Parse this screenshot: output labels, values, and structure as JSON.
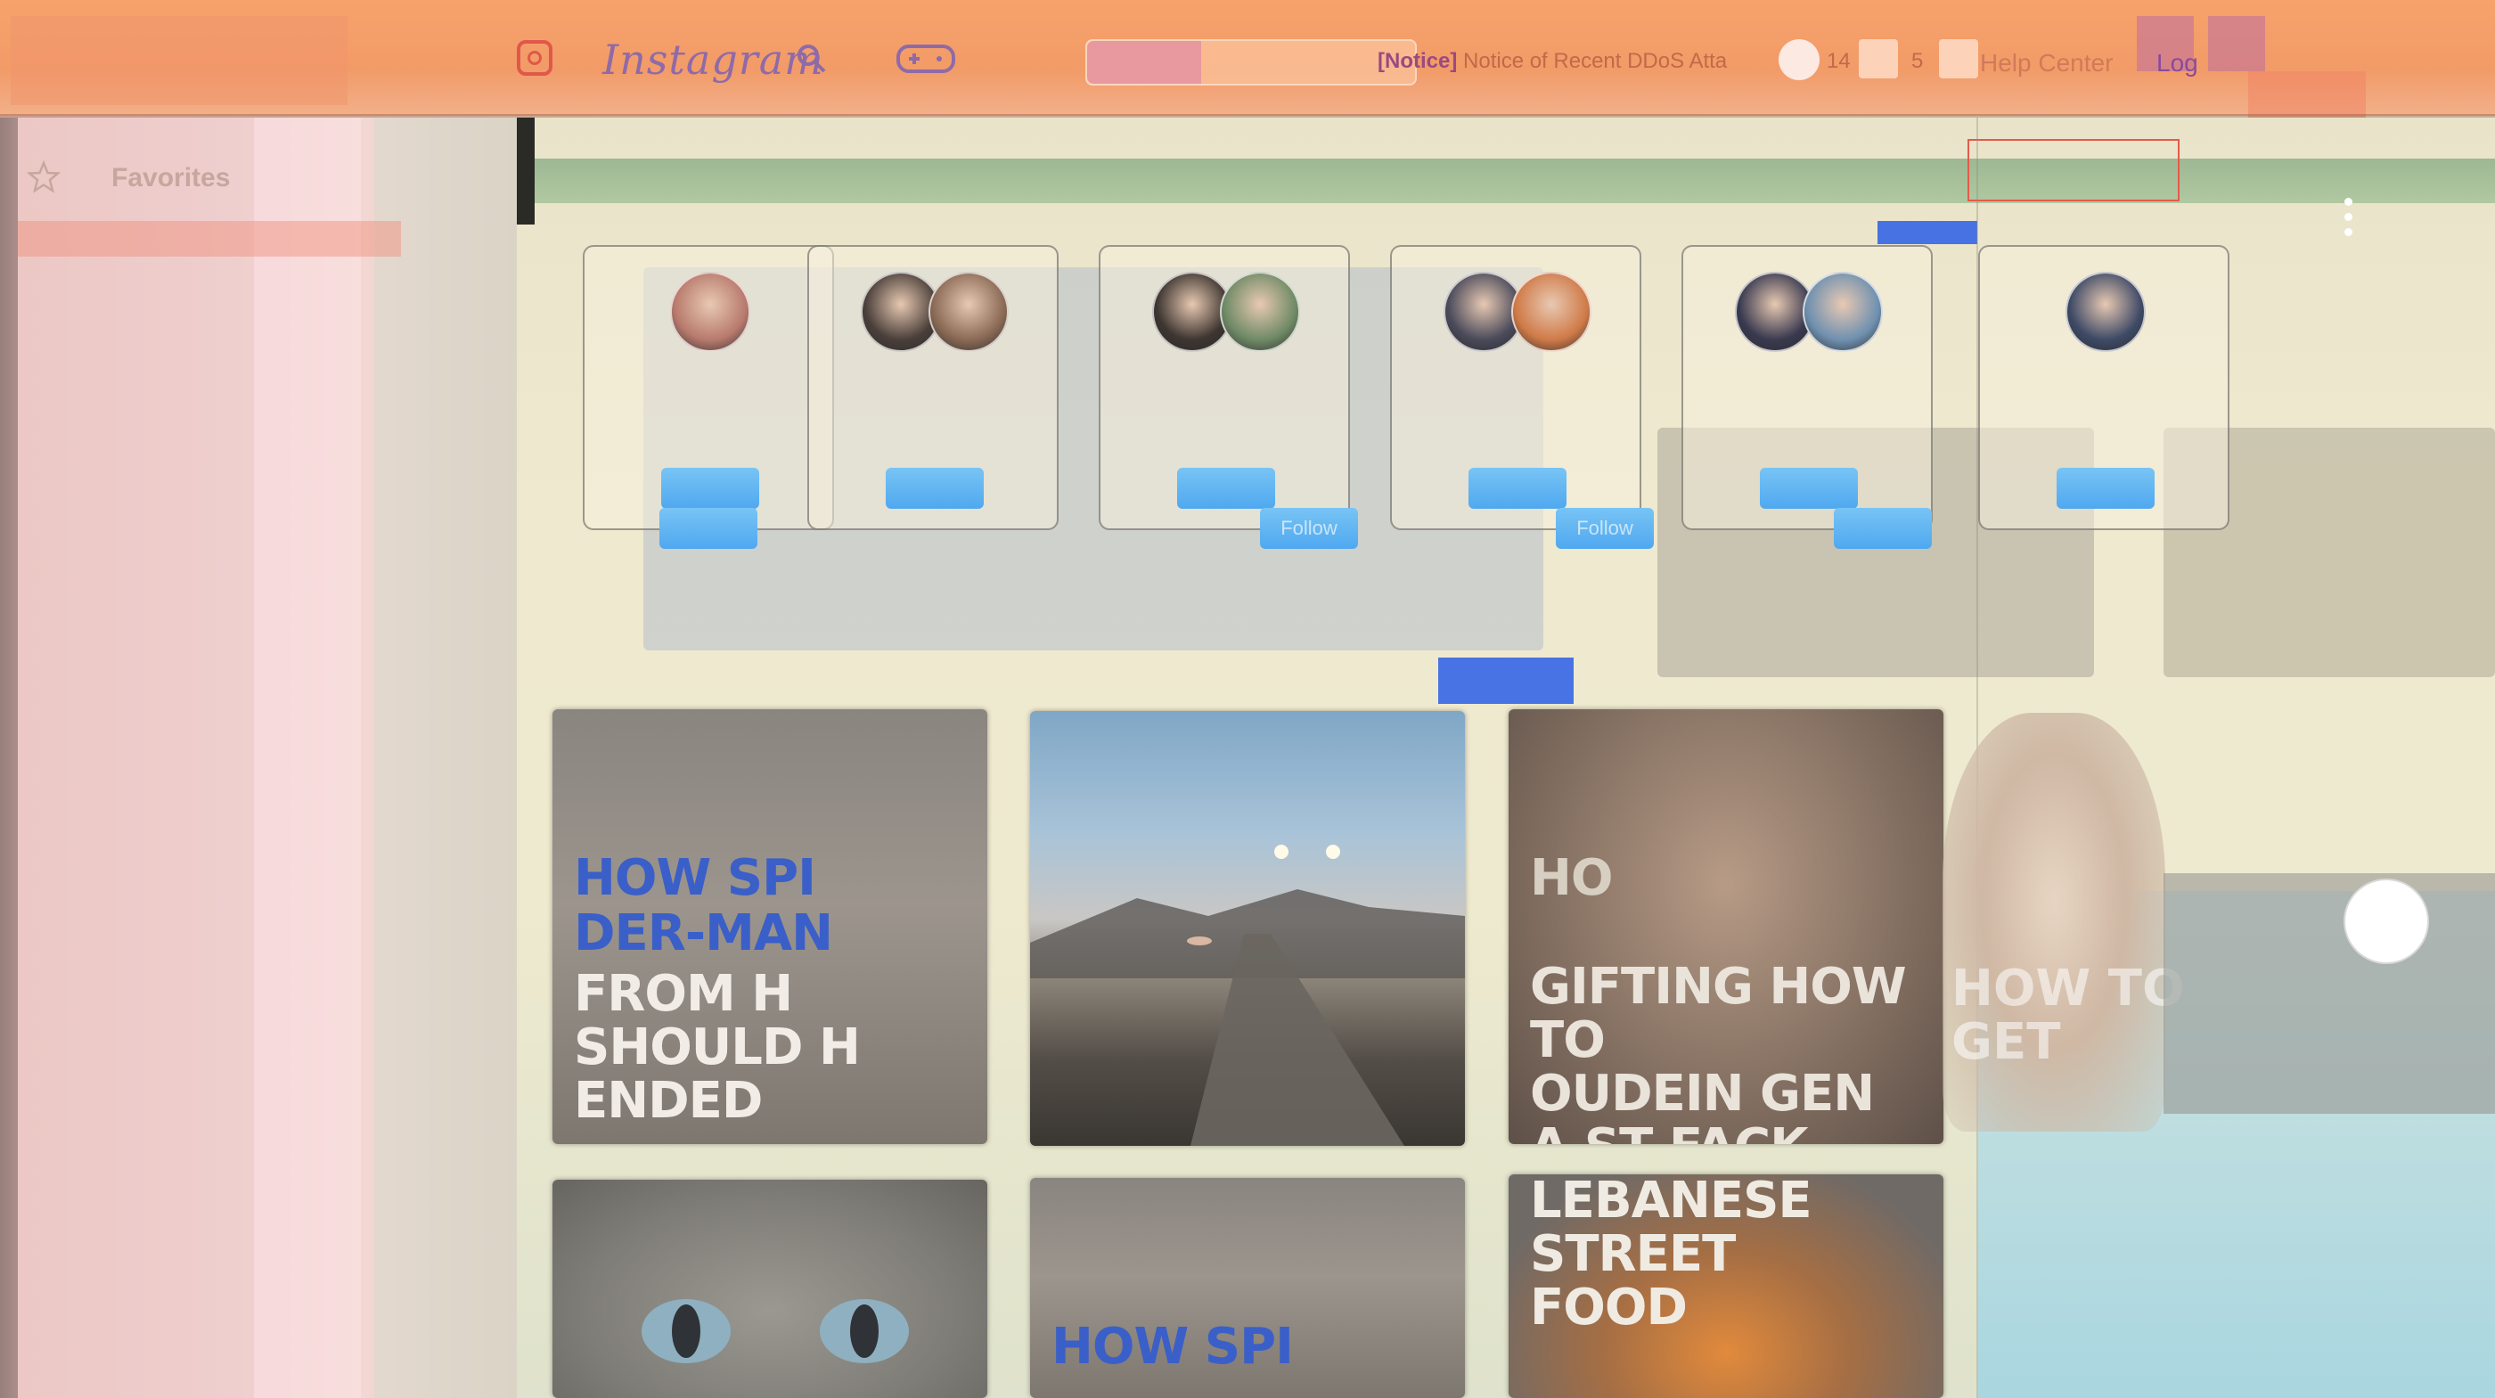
{
  "browser": {
    "logo_text": "Instagram",
    "notice_prefix": "[Notice]",
    "notice_text": " Notice of Recent DDoS Atta",
    "num_a": "14",
    "num_b": "5",
    "help_label": "Help Center",
    "login_label": "Log"
  },
  "sidebar": {
    "favorites_label": "Favorites"
  },
  "suggestions": {
    "follow_label": "Follow",
    "cards": [
      {
        "avatars": [
          "#b87a6d"
        ]
      },
      {
        "avatars": [
          "#4a3f3a",
          "#8a6a55"
        ]
      },
      {
        "avatars": [
          "#3d3530",
          "#6f8a66"
        ]
      },
      {
        "avatars": [
          "#4a4a5a",
          "#d07a48"
        ]
      },
      {
        "avatars": [
          "#3a3a50",
          "#6f90b0"
        ]
      },
      {
        "avatars": [
          "#3e4a66"
        ]
      }
    ]
  },
  "posts": {
    "headline_1a": "HOW SPI",
    "headline_1b": "DER-MAN",
    "headline_1c": "FROM H\nSHOULD H\nENDED",
    "headline_3a": "HO",
    "headline_3b": "GIFTING HOW TO\nOUDEIN GEN\nA ST FACK",
    "headline_4": "HOW TO\nGET",
    "headline_food": "LEBANESE\nSTREET\nFOOD",
    "headline_bottom": "HOW SPI"
  },
  "colors": {
    "accent_blue": "#2a5ee8",
    "follow_blue": "#4fa8ef",
    "topbar": "#f29b68"
  }
}
